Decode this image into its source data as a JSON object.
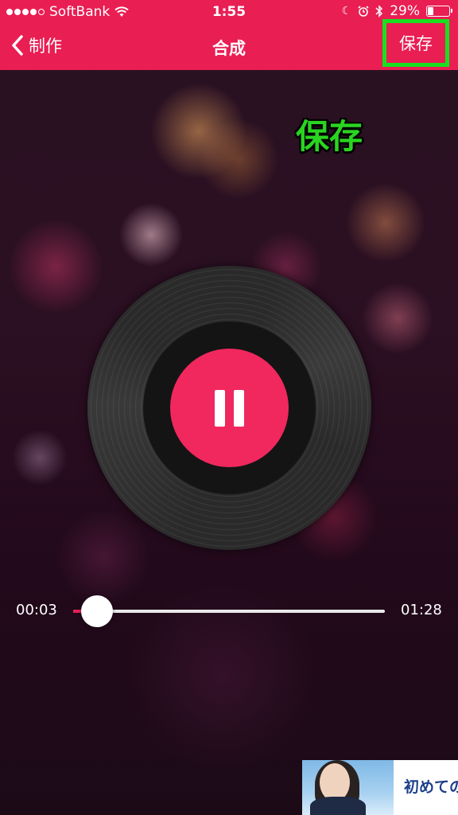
{
  "status_bar": {
    "carrier": "SoftBank",
    "time": "1:55",
    "battery_percent": "29%",
    "battery_level": 0.29
  },
  "nav": {
    "back_label": "制作",
    "title": "合成",
    "save_label": "保存"
  },
  "annotation": {
    "text": "保存",
    "color": "#2bd421"
  },
  "player": {
    "current_time": "00:03",
    "total_time": "01:28",
    "progress": 0.034
  },
  "ad": {
    "text": "初めての"
  },
  "colors": {
    "accent": "#e91e53",
    "pause_button": "#f0285e",
    "highlight_box": "#18e020"
  }
}
